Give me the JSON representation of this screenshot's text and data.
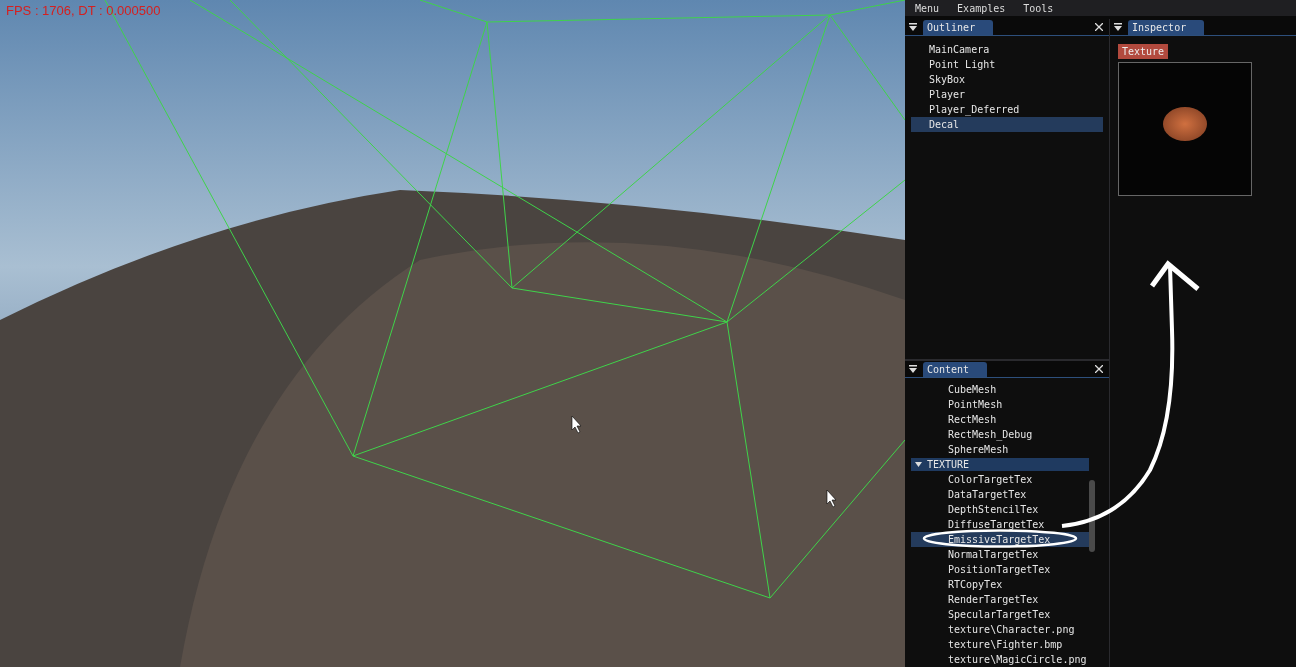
{
  "viewport": {
    "stats": "FPS : 1706, DT : 0.000500"
  },
  "menu": [
    "Menu",
    "Examples",
    "Tools"
  ],
  "outliner": {
    "title": "Outliner",
    "items": [
      {
        "label": "MainCamera",
        "selected": false
      },
      {
        "label": "Point Light",
        "selected": false
      },
      {
        "label": "SkyBox",
        "selected": false
      },
      {
        "label": "Player",
        "selected": false
      },
      {
        "label": "Player_Deferred",
        "selected": false
      },
      {
        "label": "Decal",
        "selected": true
      }
    ]
  },
  "inspector": {
    "title": "Inspector",
    "button": "Texture"
  },
  "content": {
    "title": "Content",
    "items": [
      {
        "kind": "leaf",
        "label": "CubeMesh",
        "selected": false
      },
      {
        "kind": "leaf",
        "label": "PointMesh",
        "selected": false
      },
      {
        "kind": "leaf",
        "label": "RectMesh",
        "selected": false
      },
      {
        "kind": "leaf",
        "label": "RectMesh_Debug",
        "selected": false
      },
      {
        "kind": "leaf",
        "label": "SphereMesh",
        "selected": false
      },
      {
        "kind": "folder",
        "label": "TEXTURE",
        "expanded": true,
        "selected": false,
        "children": [
          {
            "kind": "leaf",
            "label": "ColorTargetTex",
            "selected": false
          },
          {
            "kind": "leaf",
            "label": "DataTargetTex",
            "selected": false
          },
          {
            "kind": "leaf",
            "label": "DepthStencilTex",
            "selected": false
          },
          {
            "kind": "leaf",
            "label": "DiffuseTargetTex",
            "selected": false
          },
          {
            "kind": "leaf",
            "label": "EmissiveTargetTex",
            "selected": true
          },
          {
            "kind": "leaf",
            "label": "NormalTargetTex",
            "selected": false
          },
          {
            "kind": "leaf",
            "label": "PositionTargetTex",
            "selected": false
          },
          {
            "kind": "leaf",
            "label": "RTCopyTex",
            "selected": false
          },
          {
            "kind": "leaf",
            "label": "RenderTargetTex",
            "selected": false
          },
          {
            "kind": "leaf",
            "label": "SpecularTargetTex",
            "selected": false
          },
          {
            "kind": "leaf",
            "label": "texture\\Character.png",
            "selected": false
          },
          {
            "kind": "leaf",
            "label": "texture\\Fighter.bmp",
            "selected": false
          },
          {
            "kind": "leaf",
            "label": "texture\\MagicCircle.png",
            "selected": false
          }
        ]
      }
    ]
  }
}
